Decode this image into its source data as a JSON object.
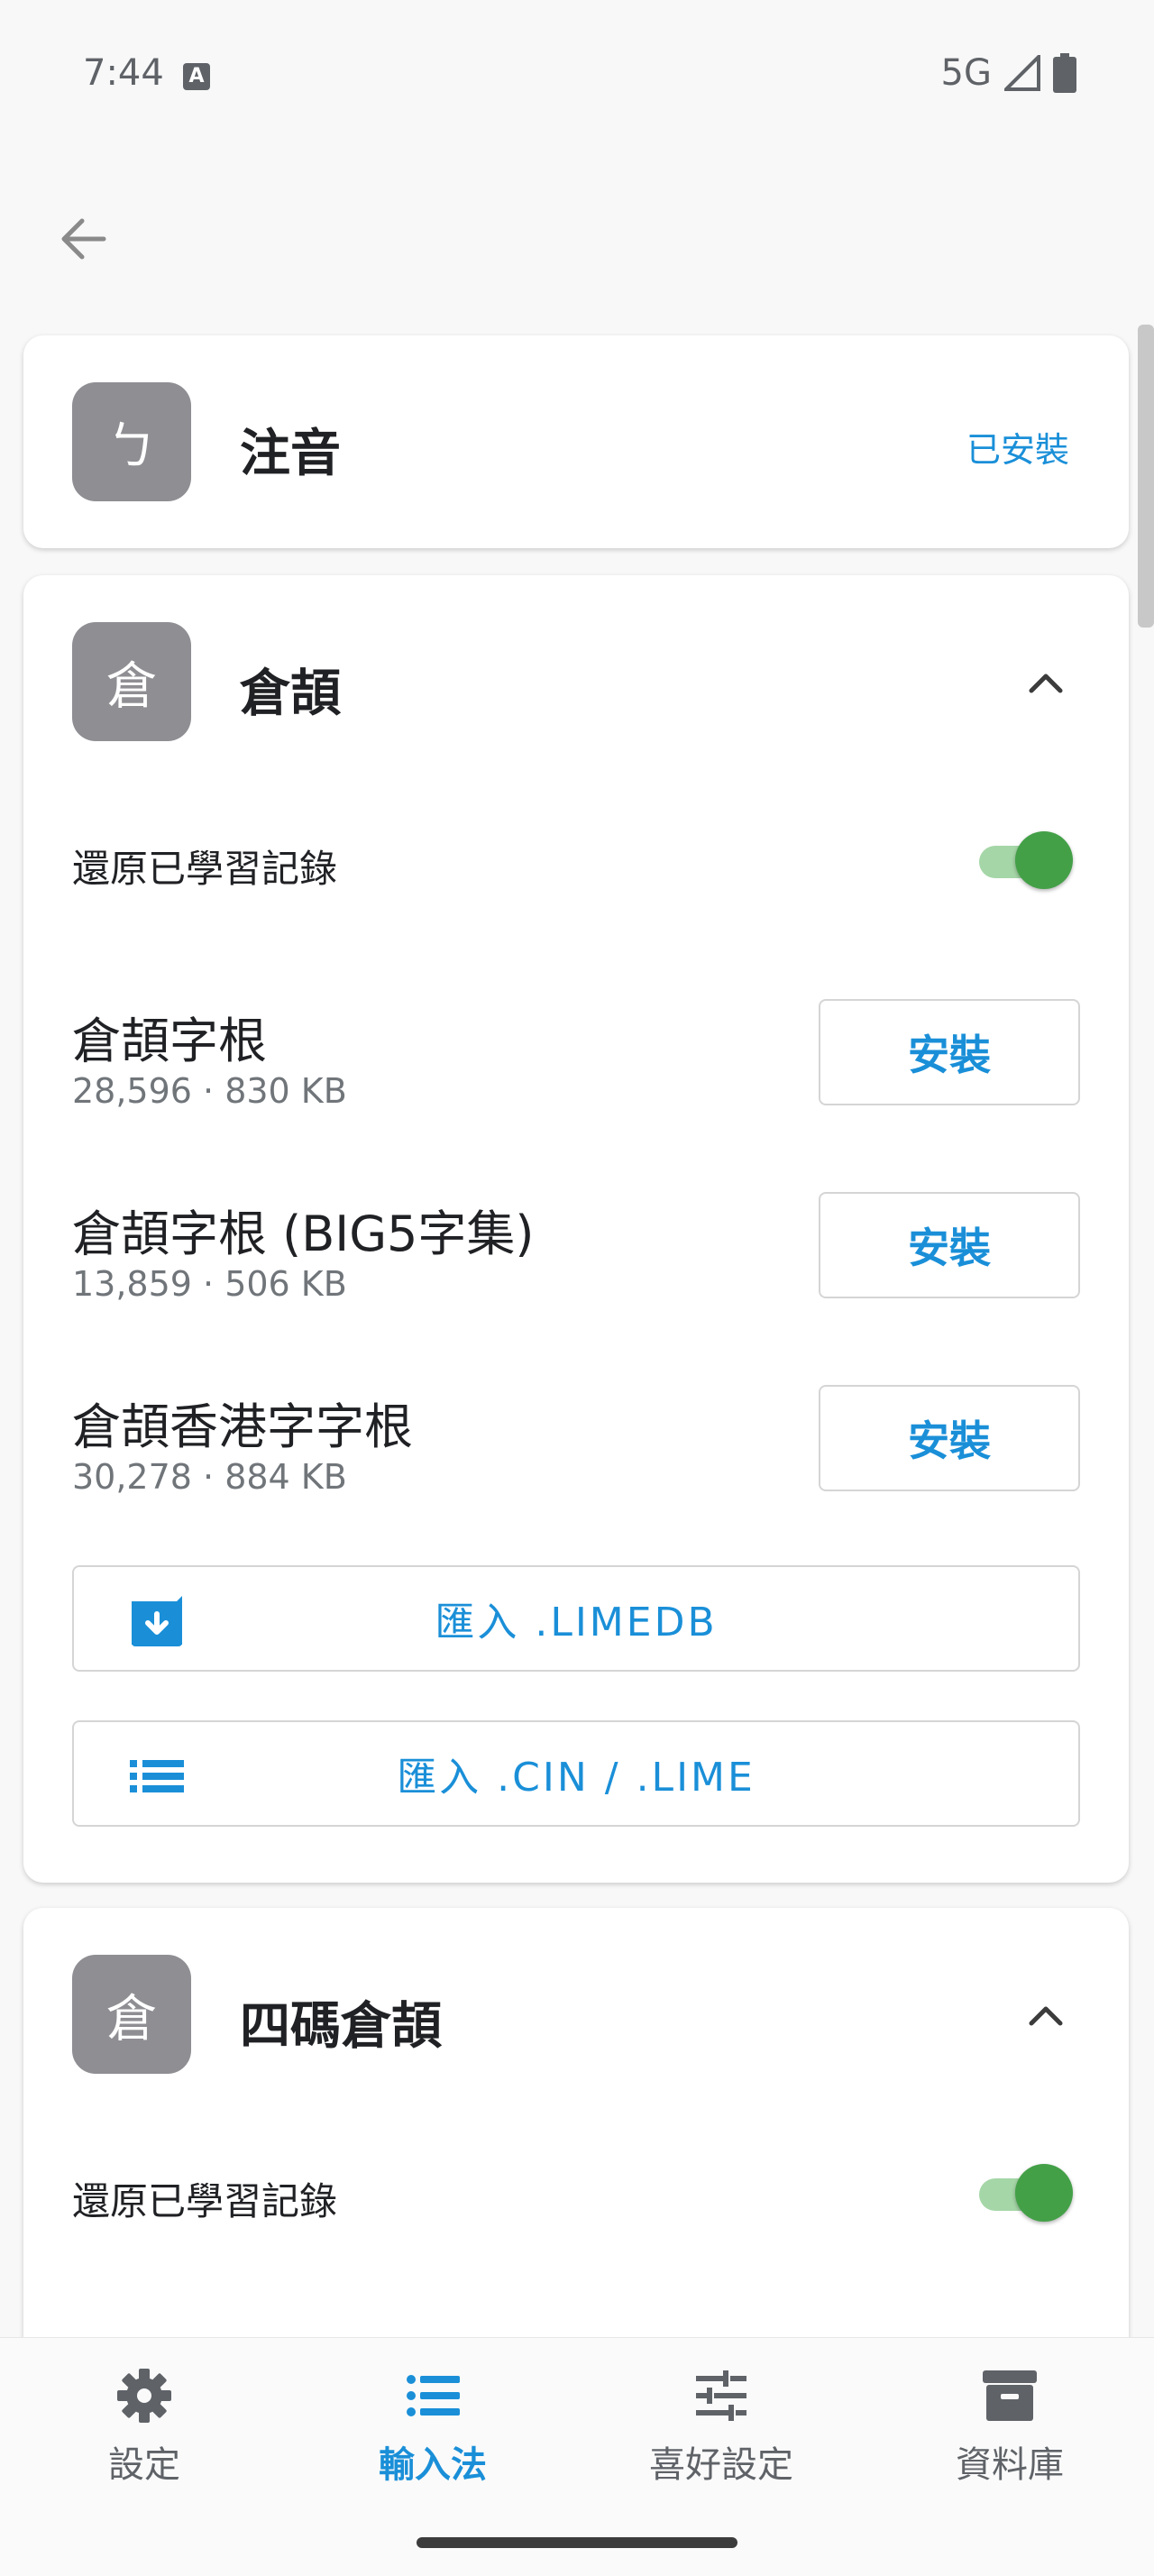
{
  "status_bar": {
    "time": "7:44",
    "notification_icon": "A",
    "network": "5G"
  },
  "colors": {
    "accent": "#1a8fd8",
    "toggle_on": "#43a047",
    "avatar_bg": "#8f8e93"
  },
  "cards": {
    "zhuyin": {
      "avatar": "ㄅ",
      "title": "注音",
      "status": "已安裝"
    },
    "cangjie": {
      "avatar": "倉",
      "title": "倉頡",
      "toggle_label": "還原已學習記錄",
      "toggle_on": true,
      "tables": [
        {
          "name": "倉頡字根",
          "meta": "28,596 · 830 KB",
          "action": "安裝"
        },
        {
          "name": "倉頡字根 (BIG5字集)",
          "meta": "13,859 · 506 KB",
          "action": "安裝"
        },
        {
          "name": "倉頡香港字字根",
          "meta": "30,278 · 884 KB",
          "action": "安裝"
        }
      ],
      "import_limedb": "匯入 .LIMEDB",
      "import_cin": "匯入 .CIN / .LIME"
    },
    "cangjie4": {
      "avatar": "倉",
      "title": "四碼倉頡",
      "toggle_label": "還原已學習記錄",
      "toggle_on": true
    }
  },
  "bottom_nav": {
    "items": [
      {
        "label": "設定",
        "icon": "gear-icon",
        "active": false
      },
      {
        "label": "輸入法",
        "icon": "list-icon",
        "active": true
      },
      {
        "label": "喜好設定",
        "icon": "tune-icon",
        "active": false
      },
      {
        "label": "資料庫",
        "icon": "archive-icon",
        "active": false
      }
    ]
  }
}
